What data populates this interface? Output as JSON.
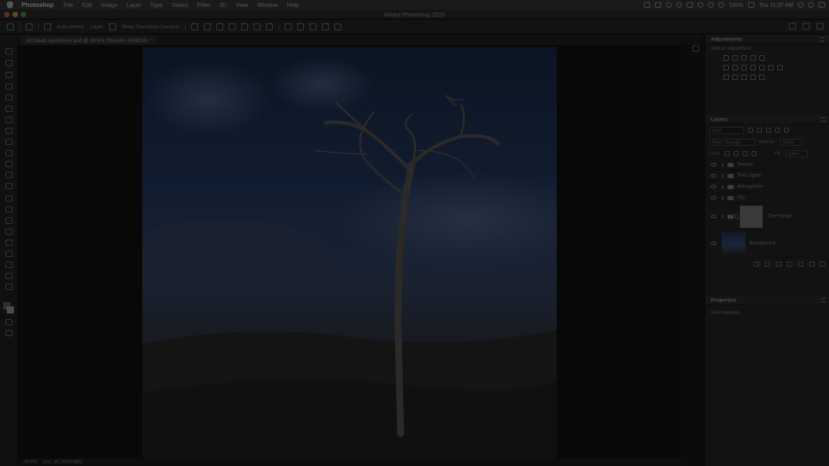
{
  "menubar": {
    "app_name": "Photoshop",
    "items": [
      "File",
      "Edit",
      "Image",
      "Layer",
      "Type",
      "Select",
      "Filter",
      "3D",
      "View",
      "Window",
      "Help"
    ],
    "battery": "100%",
    "clock": "Thu 11:37 AM"
  },
  "window": {
    "title": "Adobe Photoshop 2020",
    "traffic_colors": [
      "#5a2b27",
      "#5a4a20",
      "#23472a"
    ]
  },
  "options_bar": {
    "auto_select_label": "Auto-Select:",
    "layer_label": "Layer",
    "transform_label": "Show Transform Controls"
  },
  "document": {
    "tab_label": "9214AdjLayerDemo.psd @ 26.6% (Texture, RGB/16) *"
  },
  "status_bar": {
    "zoom": "26.6%",
    "info": "Doc: 96.2M/3.98G"
  },
  "panels": {
    "adjustments": {
      "title": "Adjustments",
      "subtitle": "Add an adjustment"
    },
    "layers": {
      "title": "Layers",
      "kind_label": "Kind",
      "blend_mode": "Pass Through",
      "opacity_label": "Opacity:",
      "opacity_value": "100%",
      "lock_label": "Lock:",
      "fill_label": "Fill:",
      "fill_value": "100%",
      "items": [
        {
          "name": "Texture",
          "type": "group"
        },
        {
          "name": "Tree Lights",
          "type": "group"
        },
        {
          "name": "Atmosphere",
          "type": "group"
        },
        {
          "name": "Sky",
          "type": "group"
        },
        {
          "name": "Tree Smart",
          "type": "smart"
        },
        {
          "name": "Background",
          "type": "image"
        }
      ]
    },
    "properties": {
      "title": "Properties",
      "empty_text": "No Properties"
    }
  }
}
